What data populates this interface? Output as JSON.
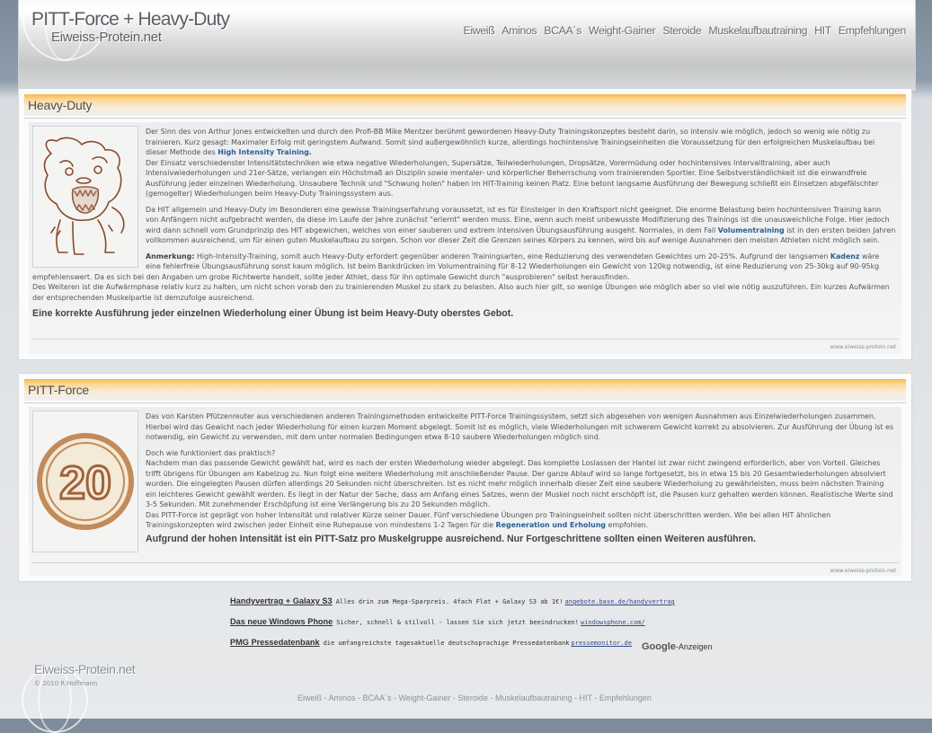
{
  "header": {
    "title": "PITT-Force + Heavy-Duty",
    "subtitle": "Eiweiss-Protein.net",
    "nav": [
      "Eiweiß",
      "Aminos",
      "BCAA´s",
      "Weight-Gainer",
      "Steroide",
      "Muskelaufbautraining",
      "HIT",
      "Empfehlungen"
    ]
  },
  "heavy_duty": {
    "heading": "Heavy-Duty",
    "image_icon": "cartoon-pitbull-icon",
    "p1_a": "Der Sinn des von Arthur Jones entwickelten und durch den Profi-BB Mike Mentzer berühmt gewordenen Heavy-Duty Trainingskonzeptes besteht darin, so intensiv wie möglich, jedoch so wenig wie nötig zu trainieren. Kurz gesagt: Maximaler Erfolg mit geringstem Aufwand. Somit sind außergewöhnlich kurze, allerdings hochintensive Trainingseinheiten die Voraussetzung für den erfolgreichen Muskelaufbau bei dieser Methode des ",
    "p1_link": "High Intensity Training.",
    "p1_b": "Der Einsatz verschiedenster Intensitätstechniken wie etwa negative Wiederholungen, Supersätze, Teilwiederholungen, Dropsätze, Vorermüdung oder hochintensives Intervalltraining, aber auch Intensivwiederholungen und 21er-Sätze, verlangen ein Höchstmaß an Disziplin sowie mentaler- und körperlicher Beherrschung vom trainierenden Sportler. Eine Selbstverständlichkeit ist die einwandfreie Ausführung jeder einzelnen Wiederholung. Unsaubere Technik und \"Schwung holen\" haben im HIT-Training keinen Platz. Eine betont langsame Ausführung der Bewegung schließt ein Einsetzen abgefälschter (gemogelter) Wiederholungen beim Heavy-Duty Trainingssystem aus.",
    "p2_a": "Da HIT allgemein und Heavy-Duty im Besonderen eine gewisse Trainingserfahrung voraussetzt, ist es für Einsteiger in den Kraftsport nicht geeignet. Die enorme Belastung beim hochintensiven Training kann von Anfängern nicht aufgebracht werden, da diese im Laufe der Jahre zunächst \"erlernt\" werden muss. Eine, wenn auch meist unbewusste Modifizierung des Trainings ist die unausweichliche Folge. Hier jedoch wird dann schnell vom Grundprinzip des HIT abgewichen, welches von einer sauberen und extrem intensiven Übungsausführung ausgeht. Normales, in dem Fall ",
    "p2_link": "Volumentraining",
    "p2_b": " ist in den ersten beiden Jahren vollkommen ausreichend, um für einen guten Muskelaufbau zu sorgen. Schon vor dieser Zeit die Grenzen seines Körpers zu kennen, wird bis auf wenige Ausnahmen den meisten Athleten nicht möglich sein.",
    "p3_label": "Anmerkung:",
    "p3_a": " High-Intensity-Training, somit auch Heavy-Duty erfordert gegenüber anderen Trainingsarten, eine Reduzierung des verwendeten Gewichtes um 20-25%. Aufgrund der langsamen ",
    "p3_link": "Kadenz",
    "p3_b": " wäre eine fehlerfreie Übungsausführung sonst kaum möglich. Ist beim Bankdrücken im Volumentraining für 8-12 Wiederholungen ein Gewicht von 120kg notwendig, ist eine Reduzierung von 25-30kg auf 90-95kg empfehlenswert. Da es sich bei den Angaben um grobe Richtwerte handelt, sollte jeder Athlet, dass für ihn optimale Gewicht durch \"ausprobieren\" selbst herausfinden.",
    "p3_c": "Des Weiteren ist die Aufwärmphase relativ kurz zu halten, um nicht schon vorab den zu trainierenden Muskel zu stark zu belasten. Also auch hier gilt, so wenige Übungen wie möglich aber so viel wie nötig auszuführen. Ein kurzes Aufwärmen der entsprechenden Muskelpartie ist demzufolge ausreichend.",
    "summary": "Eine korrekte Ausführung jeder einzelnen Wiederholung einer Übung ist beim Heavy-Duty oberstes Gebot.",
    "credit": "www.eiweiss-protein.net"
  },
  "pitt_force": {
    "heading": "PITT-Force",
    "image_icon": "number-20-medal-icon",
    "image_number": "20",
    "p1": "Das von Karsten Pfützenreuter aus verschiedenen anderen Trainingsmethoden entwickelte PITT-Force Trainingssystem, setzt sich abgesehen von wenigen Ausnahmen aus Einzelwiederholungen zusammen. Hierbei wird das Gewicht nach jeder Wiederholung für einen kurzen Moment abgelegt. Somit ist es möglich, viele Wiederholungen mit schwerem Gewicht korrekt zu absolvieren. Zur Ausführung der Übung ist es notwendig, ein Gewicht zu verwenden, mit dem unter normalen Bedingungen etwa 8-10 saubere Wiederholungen möglich sind.",
    "p2_q": "Doch wie funktioniert das praktisch?",
    "p2": "Nachdem man das passende Gewicht gewählt hat, wird es nach der ersten Wiederholung wieder abgelegt. Das komplette Loslassen der Hantel ist zwar nicht zwingend erforderlich, aber von Vorteil. Gleiches trifft übrigens für Übungen am Kabelzug zu. Nun folgt eine weitere Wiederholung mit anschließender Pause. Der ganze Ablauf wird so lange fortgesetzt, bis in etwa 15 bis 20 Gesamtwiederholungen absolviert wurden. Die eingelegten Pausen dürfen allerdings 20 Sekunden nicht überschreiten. Ist es nicht mehr möglich innerhalb dieser Zeit eine saubere Wiederholung zu gewährleisten, muss beim nächsten Training ein leichteres Gewicht gewählt werden. Es liegt in der Natur der Sache, dass am Anfang eines Satzes, wenn der Muskel noch nicht erschöpft ist, die Pausen kurz gehalten werden können. Realistische Werte sind 3-5 Sekunden. Mit zunehmender Erschöpfung ist eine Verlängerung bis zu 20 Sekunden möglich.",
    "p3_a": "Das PITT-Force ist geprägt von hoher Intensität und relativer Kürze seiner Dauer. Fünf verschiedene Übungen pro Trainingseinheit sollten nicht überschritten werden. Wie bei allen HIT ähnlichen Trainingskonzepten wird zwischen jeder Einheit eine Ruhepause von mindestens 1-2 Tagen für die ",
    "p3_link": "Regeneration und Erholung",
    "p3_b": " empfohlen.",
    "summary": "Aufgrund der hohen Intensität ist ein PITT-Satz pro Muskelgruppe ausreichend. Nur Fortgeschrittene sollten einen Weiteren ausführen.",
    "credit": "www.eiweiss-protein.net"
  },
  "ads": [
    {
      "title": "Handyvertrag + Galaxy S3",
      "text": "Alles drin zum Mega-Sparpreis. 4fach Flat + Galaxy S3 ab 1€!",
      "link": "angebote.base.de/handyvertrag"
    },
    {
      "title": "Das neue Windows Phone",
      "text": "Sicher, schnell & stilvoll - lassen Sie sich jetzt beeindrucken!",
      "link": "windowsphone.com/"
    },
    {
      "title": "PMG Pressedatenbank",
      "text": "die umfangreichste tagesaktuelle deutschsprachige Pressedatenbank",
      "link": "pressemonitor.de"
    }
  ],
  "google_ads": {
    "brand": "Google",
    "suffix": "-Anzeigen"
  },
  "footer": {
    "logo": "Eiweiss-Protein.net",
    "copyright": "© 2010 R.Hoffmann",
    "nav": [
      "Eiweiß",
      "Aminos",
      "BCAA´s",
      "Weight-Gainer",
      "Steroide",
      "Muskelaufbautraining",
      "HIT",
      "Empfehlungen"
    ],
    "separator": " - "
  },
  "colors": {
    "accent": "#f6b84a",
    "link": "#2b5f93",
    "text": "#555555"
  }
}
